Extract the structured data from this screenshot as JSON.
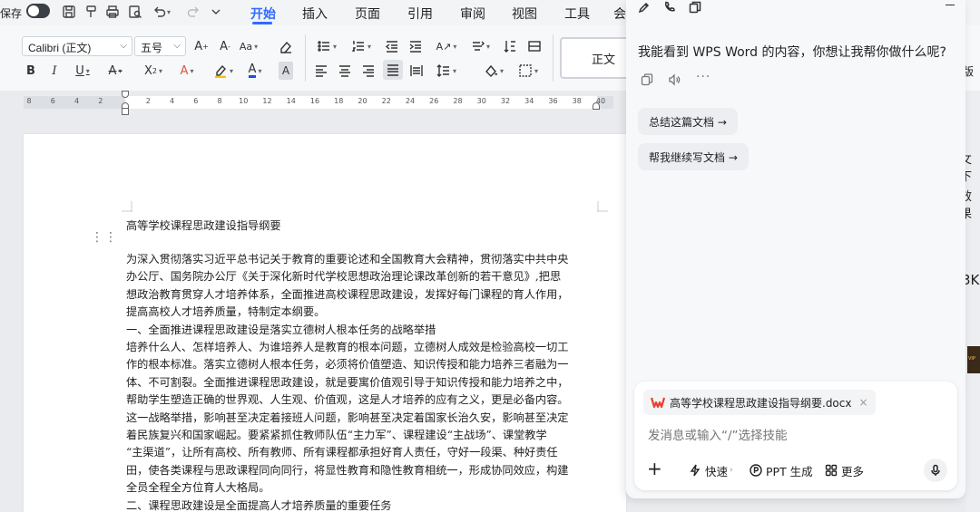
{
  "topbar": {
    "save_label": "保存",
    "tabs": [
      {
        "label": "开始",
        "active": true
      },
      {
        "label": "插入"
      },
      {
        "label": "页面"
      },
      {
        "label": "引用"
      },
      {
        "label": "审阅"
      },
      {
        "label": "视图"
      },
      {
        "label": "工具"
      },
      {
        "label": "会"
      }
    ]
  },
  "ribbon": {
    "font_name": "Calibri (正文)",
    "font_size": "五号",
    "style_normal": "正文"
  },
  "ruler": {
    "ticks": [
      "8",
      "6",
      "4",
      "2",
      "",
      "2",
      "4",
      "6",
      "8",
      "10",
      "12",
      "14",
      "16",
      "18",
      "20",
      "22",
      "24",
      "26",
      "28",
      "30",
      "32",
      "34",
      "36",
      "38",
      "40"
    ]
  },
  "document": {
    "title": "高等学校课程思政建设指导纲要",
    "lines": [
      "为深入贯彻落实习近平总书记关于教育的重要论述和全国教育大会精神，贯彻落实中共中央",
      "办公厅、国务院办公厅《关于深化新时代学校思想政治理论课改革创新的若干意见》,把思",
      "想政治教育贯穿人才培养体系，全面推进高校课程思政建设，发挥好每门课程的育人作用，",
      "提高高校人才培养质量，特制定本纲要。",
      "一、全面推进课程思政建设是落实立德树人根本任务的战略举措",
      "培养什么人、怎样培养人、为谁培养人是教育的根本问题，立德树人成效是检验高校一切工",
      "作的根本标准。落实立德树人根本任务，必须将价值塑造、知识传授和能力培养三者融为一",
      "体、不可割裂。全面推进课程思政建设，就是要寓价值观引导于知识传授和能力培养之中，",
      "帮助学生塑造正确的世界观、人生观、价值观，这是人才培养的应有之义，更是必备内容。",
      "这一战略举措，影响甚至决定着接班人问题，影响甚至决定着国家长治久安，影响甚至决定",
      "着民族复兴和国家崛起。要紧紧抓住教师队伍“主力军”、课程建设“主战场”、课堂教学",
      "“主渠道”，让所有高校、所有教师、所有课程都承担好育人责任，守好一段渠、种好责任",
      "田，使各类课程与思政课程同向同行，将显性教育和隐性教育相统一，形成协同效应，构建",
      "全员全程全方位育人大格局。",
      "二、课程思政建设是全面提高人才培养质量的重要任务"
    ]
  },
  "side_strip": {
    "text_1": "版",
    "text_2": "攵下",
    "text_3": "效果",
    "text_4": "3K",
    "vip": "VIP"
  },
  "ai_panel": {
    "message": "我能看到 WPS Word 的内容，你想让我帮你做什么呢?",
    "suggestions": [
      "总结这篇文档 →",
      "帮我继续写文档 →"
    ],
    "attachment_name": "高等学校课程思政建设指导纲要.docx",
    "input_placeholder": "发消息或输入“/”选择技能",
    "tools": {
      "quick": "快速",
      "ppt": "PPT 生成",
      "more": "更多"
    }
  }
}
